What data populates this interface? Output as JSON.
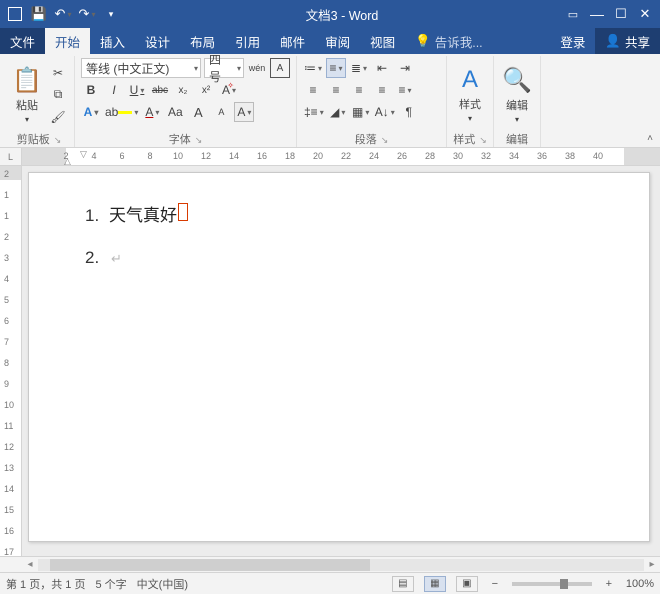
{
  "titlebar": {
    "doc_title": "文档3 - Word"
  },
  "tabs": {
    "file": "文件",
    "home": "开始",
    "insert": "插入",
    "design": "设计",
    "layout": "布局",
    "references": "引用",
    "mailings": "邮件",
    "review": "审阅",
    "view": "视图",
    "tell_me": "告诉我...",
    "signin": "登录",
    "share": "共享"
  },
  "ribbon": {
    "clipboard": {
      "label": "剪贴板",
      "paste": "粘贴"
    },
    "font": {
      "label": "字体",
      "family": "等线 (中文正文)",
      "size": "四号",
      "phonetic": "wén",
      "enclosed": "A",
      "clear": "A",
      "bold": "B",
      "italic": "I",
      "underline": "U",
      "strike": "abc",
      "sub": "x₂",
      "sup": "x²",
      "effects": "A",
      "highlight_color": "#ffff00",
      "font_color": "#c00000",
      "charshade": "Aa",
      "grow": "A",
      "shrink": "A",
      "change_case": "A"
    },
    "paragraph": {
      "label": "段落"
    },
    "styles": {
      "label": "样式",
      "btn": "样式"
    },
    "editing": {
      "label": "编辑",
      "btn": "编辑"
    }
  },
  "ruler": {
    "h_ticks": [
      2,
      4,
      6,
      8,
      10,
      12,
      14,
      16,
      18,
      20,
      22,
      24,
      26,
      28,
      30,
      32,
      34,
      36,
      38,
      40
    ],
    "v_ticks": [
      2,
      1,
      1,
      2,
      3,
      4,
      5,
      6,
      7,
      8,
      9,
      10,
      11,
      12,
      13,
      14,
      15,
      16,
      17
    ]
  },
  "document": {
    "lines": [
      {
        "n": "1.",
        "text": "天气真好",
        "cursor": true
      },
      {
        "n": "2.",
        "text": "",
        "cursor": false
      }
    ]
  },
  "status": {
    "page": "第 1 页，共 1 页",
    "words": "5 个字",
    "lang": "中文(中国)",
    "zoom": "100%"
  }
}
